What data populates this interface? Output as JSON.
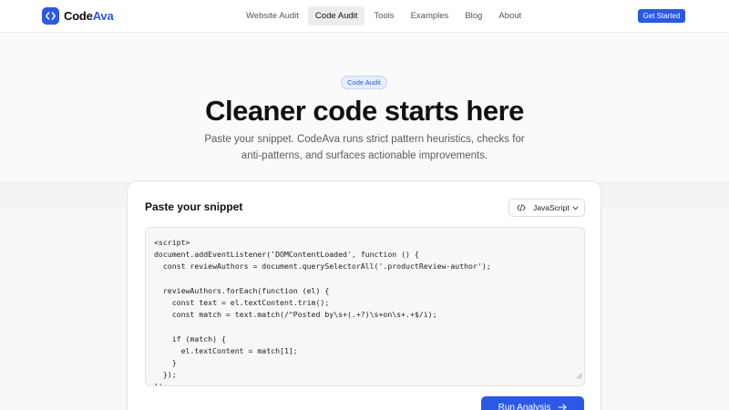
{
  "brand": {
    "name_primary": "Code",
    "name_accent": "Ava",
    "accent_color": "#2b59e6"
  },
  "nav": {
    "items": [
      {
        "label": "Website Audit",
        "active": false
      },
      {
        "label": "Code Audit",
        "active": true
      },
      {
        "label": "Tools",
        "active": false
      },
      {
        "label": "Examples",
        "active": false
      },
      {
        "label": "Blog",
        "active": false
      },
      {
        "label": "About",
        "active": false
      }
    ],
    "cta_label": "Get Started"
  },
  "hero": {
    "badge": "Code Audit",
    "title": "Cleaner code starts here",
    "subtitle": "Paste your snippet. CodeAva runs strict pattern heuristics, checks for anti-patterns, and surfaces actionable improvements."
  },
  "card": {
    "title": "Paste your snippet",
    "language": {
      "selected": "JavaScript",
      "icon": "code-icon"
    },
    "code": "<script>\ndocument.addEventListener('DOMContentLoaded', function () {\n  const reviewAuthors = document.querySelectorAll('.productReview-author');\n\n  reviewAuthors.forEach(function (el) {\n    const text = el.textContent.trim();\n    const match = text.match(/^Posted by\\s+(.+?)\\s+on\\s+.+$/i);\n\n    if (match) {\n      el.textContent = match[1];\n    }\n  });\n});",
    "run_button": {
      "label": "Run Analysis",
      "icon": "arrow-right-icon"
    }
  }
}
